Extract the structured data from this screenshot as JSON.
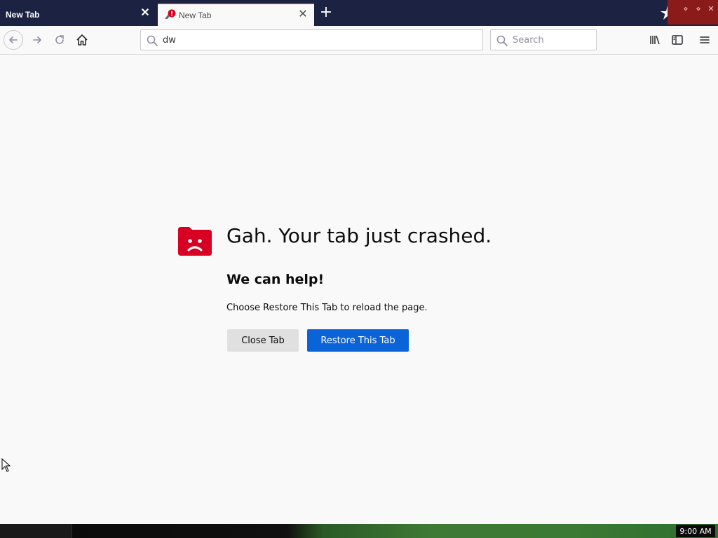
{
  "tabs": [
    {
      "title": "New Tab",
      "active": false
    },
    {
      "title": "New Tab",
      "active": true,
      "badge": "!"
    }
  ],
  "toolbar": {
    "url_value": "dw",
    "search_placeholder": "Search"
  },
  "crash": {
    "title": "Gah. Your tab just crashed.",
    "subtitle": "We can help!",
    "description": "Choose Restore This Tab to reload the page.",
    "close_label": "Close Tab",
    "restore_label": "Restore This Tab"
  },
  "taskbar": {
    "clock": "9:00 AM"
  },
  "colors": {
    "tabstrip": "#1c2242",
    "accent_active_tab": "#b02a2a",
    "restore_button": "#0a64d8",
    "crash_icon": "#d70022"
  },
  "icons": [
    "close-icon",
    "plus-icon",
    "back-arrow-icon",
    "forward-arrow-icon",
    "reload-icon",
    "home-icon",
    "search-icon",
    "library-icon",
    "sidebar-icon",
    "hamburger-menu-icon",
    "sad-folder-icon"
  ]
}
